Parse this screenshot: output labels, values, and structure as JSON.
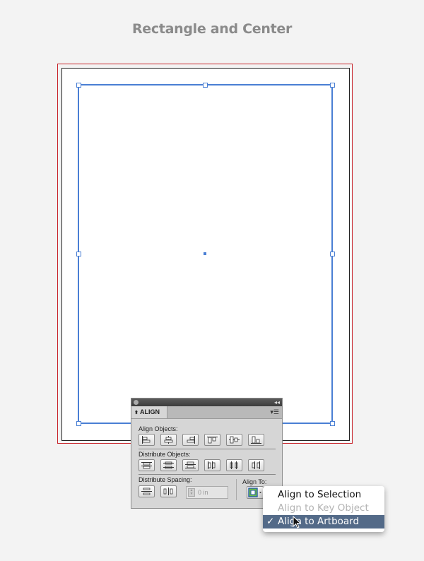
{
  "page": {
    "title": "Rectangle and Center"
  },
  "align_panel": {
    "tab_label": "ALIGN",
    "align_objects_label": "Align Objects:",
    "distribute_objects_label": "Distribute Objects:",
    "distribute_spacing_label": "Distribute Spacing:",
    "spacing_value": "0 in",
    "align_to_label": "Align To:",
    "align_object_buttons": [
      "horizontal-align-left-icon",
      "horizontal-align-center-icon",
      "horizontal-align-right-icon",
      "vertical-align-top-icon",
      "vertical-align-center-icon",
      "vertical-align-bottom-icon"
    ],
    "distribute_object_buttons": [
      "vertical-distribute-top-icon",
      "vertical-distribute-center-icon",
      "vertical-distribute-bottom-icon",
      "horizontal-distribute-left-icon",
      "horizontal-distribute-center-icon",
      "horizontal-distribute-right-icon"
    ],
    "distribute_spacing_buttons": [
      "vertical-distribute-space-icon",
      "horizontal-distribute-space-icon"
    ]
  },
  "dropdown": {
    "items": [
      {
        "label": "Align to Selection",
        "state": "normal"
      },
      {
        "label": "Align to Key Object",
        "state": "disabled"
      },
      {
        "label": "Align to Artboard",
        "state": "selected",
        "checked": true
      }
    ]
  },
  "colors": {
    "selection": "#4a7fd4",
    "bleed": "#c8242b",
    "menu_highlight": "#536a88"
  }
}
